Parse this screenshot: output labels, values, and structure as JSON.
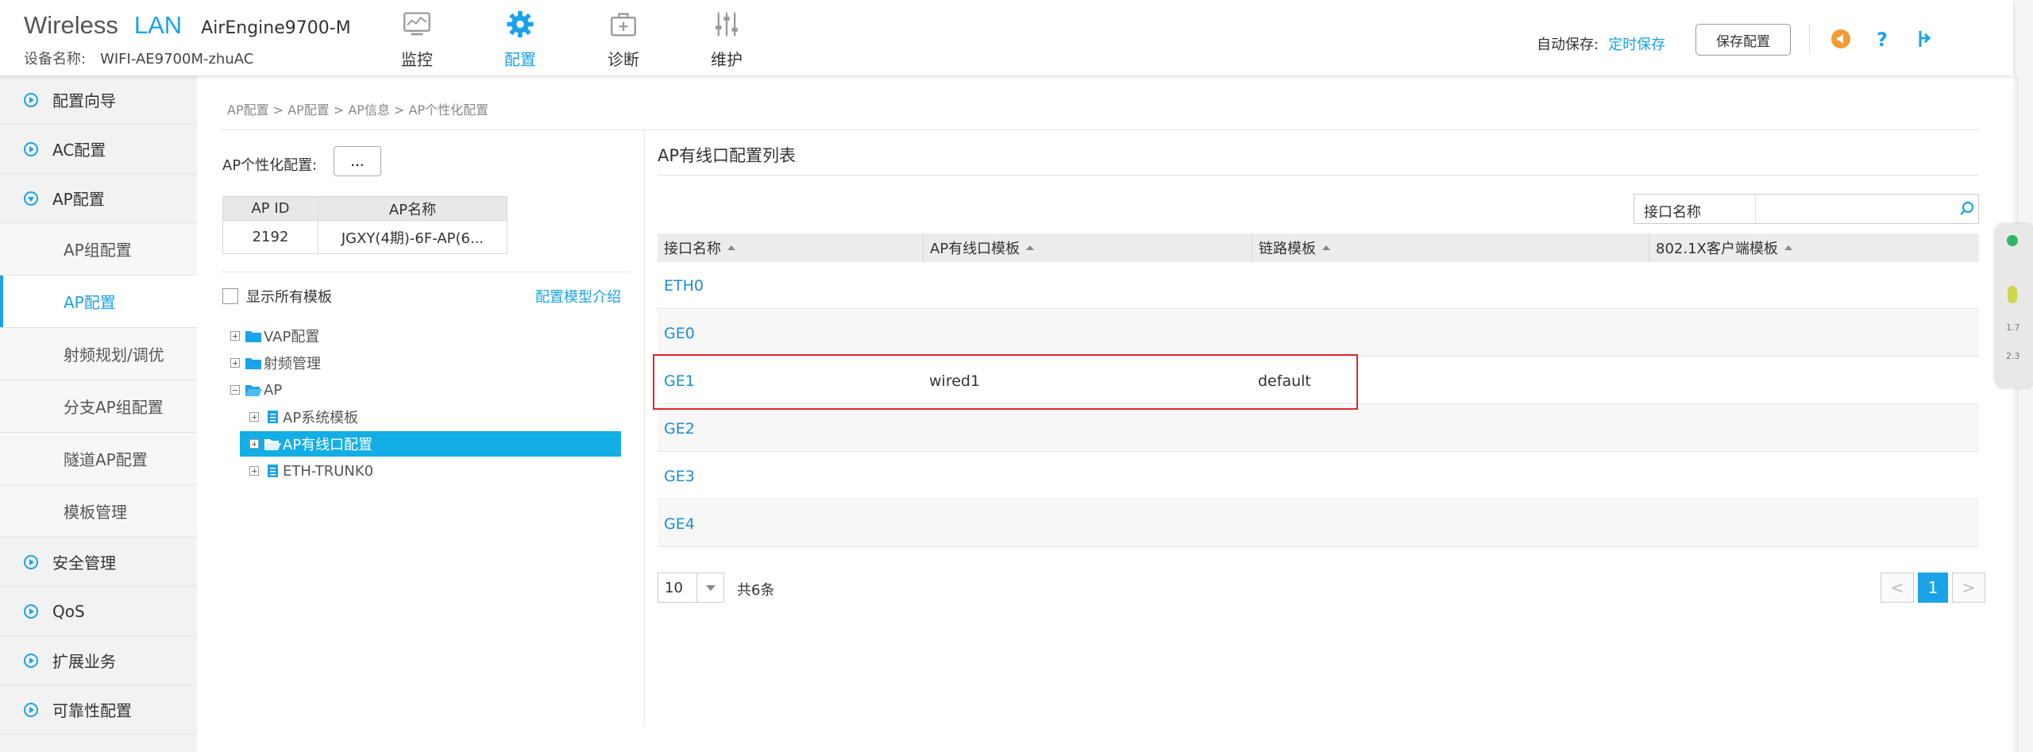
{
  "header": {
    "brand_wireless": "Wireless",
    "brand_lan": "LAN",
    "model": "AirEngine9700-M",
    "device_label": "设备名称:",
    "device_name": "WIFI-AE9700M-zhuAC",
    "nav": [
      {
        "label": "监控",
        "icon": "monitor-icon"
      },
      {
        "label": "配置",
        "icon": "gear-icon"
      },
      {
        "label": "诊断",
        "icon": "toolbox-icon"
      },
      {
        "label": "维护",
        "icon": "sliders-icon"
      }
    ],
    "autosave_label": "自动保存:",
    "autosave_value": "定时保存",
    "save_button": "保存配置",
    "accent_color": "#1aa3e8"
  },
  "sidebar": {
    "items": [
      {
        "label": "配置向导"
      },
      {
        "label": "AC配置"
      },
      {
        "label": "AP配置"
      },
      {
        "label": "安全管理"
      },
      {
        "label": "QoS"
      },
      {
        "label": "扩展业务"
      },
      {
        "label": "可靠性配置"
      }
    ],
    "sub_items": [
      {
        "label": "AP组配置"
      },
      {
        "label": "AP配置"
      },
      {
        "label": "射频规划/调优"
      },
      {
        "label": "分支AP组配置"
      },
      {
        "label": "隧道AP配置"
      },
      {
        "label": "模板管理"
      }
    ]
  },
  "breadcrumb": "AP配置 > AP配置 > AP信息 > AP个性化配置",
  "left": {
    "ap_config_label": "AP个性化配置:",
    "dots_button": "...",
    "table": {
      "headers": [
        "AP ID",
        "AP名称"
      ],
      "row": [
        "2192",
        "JGXY(4期)-6F-AP(6..."
      ]
    },
    "show_all_label": "显示所有模板",
    "model_intro_link": "配置模型介绍",
    "tree": [
      {
        "label": "VAP配置"
      },
      {
        "label": "射频管理"
      },
      {
        "label": "AP"
      },
      {
        "label": "AP系统模板"
      },
      {
        "label": "AP有线口配置"
      },
      {
        "label": "ETH-TRUNK0"
      }
    ]
  },
  "right": {
    "title": "AP有线口配置列表",
    "search_label": "接口名称",
    "search_value": "",
    "columns": [
      "接口名称",
      "AP有线口模板",
      "链路模板",
      "802.1X客户端模板"
    ],
    "rows": [
      [
        "ETH0",
        "",
        "",
        ""
      ],
      [
        "GE0",
        "",
        "",
        ""
      ],
      [
        "GE1",
        "wired1",
        "default",
        ""
      ],
      [
        "GE2",
        "",
        "",
        ""
      ],
      [
        "GE3",
        "",
        "",
        ""
      ],
      [
        "GE4",
        "",
        "",
        ""
      ]
    ],
    "page_size": "10",
    "total": "共6条",
    "pager": {
      "prev": "<",
      "current": "1",
      "next": ">"
    }
  },
  "widget": {
    "speed1": "1.7",
    "speed2": "2.3"
  }
}
